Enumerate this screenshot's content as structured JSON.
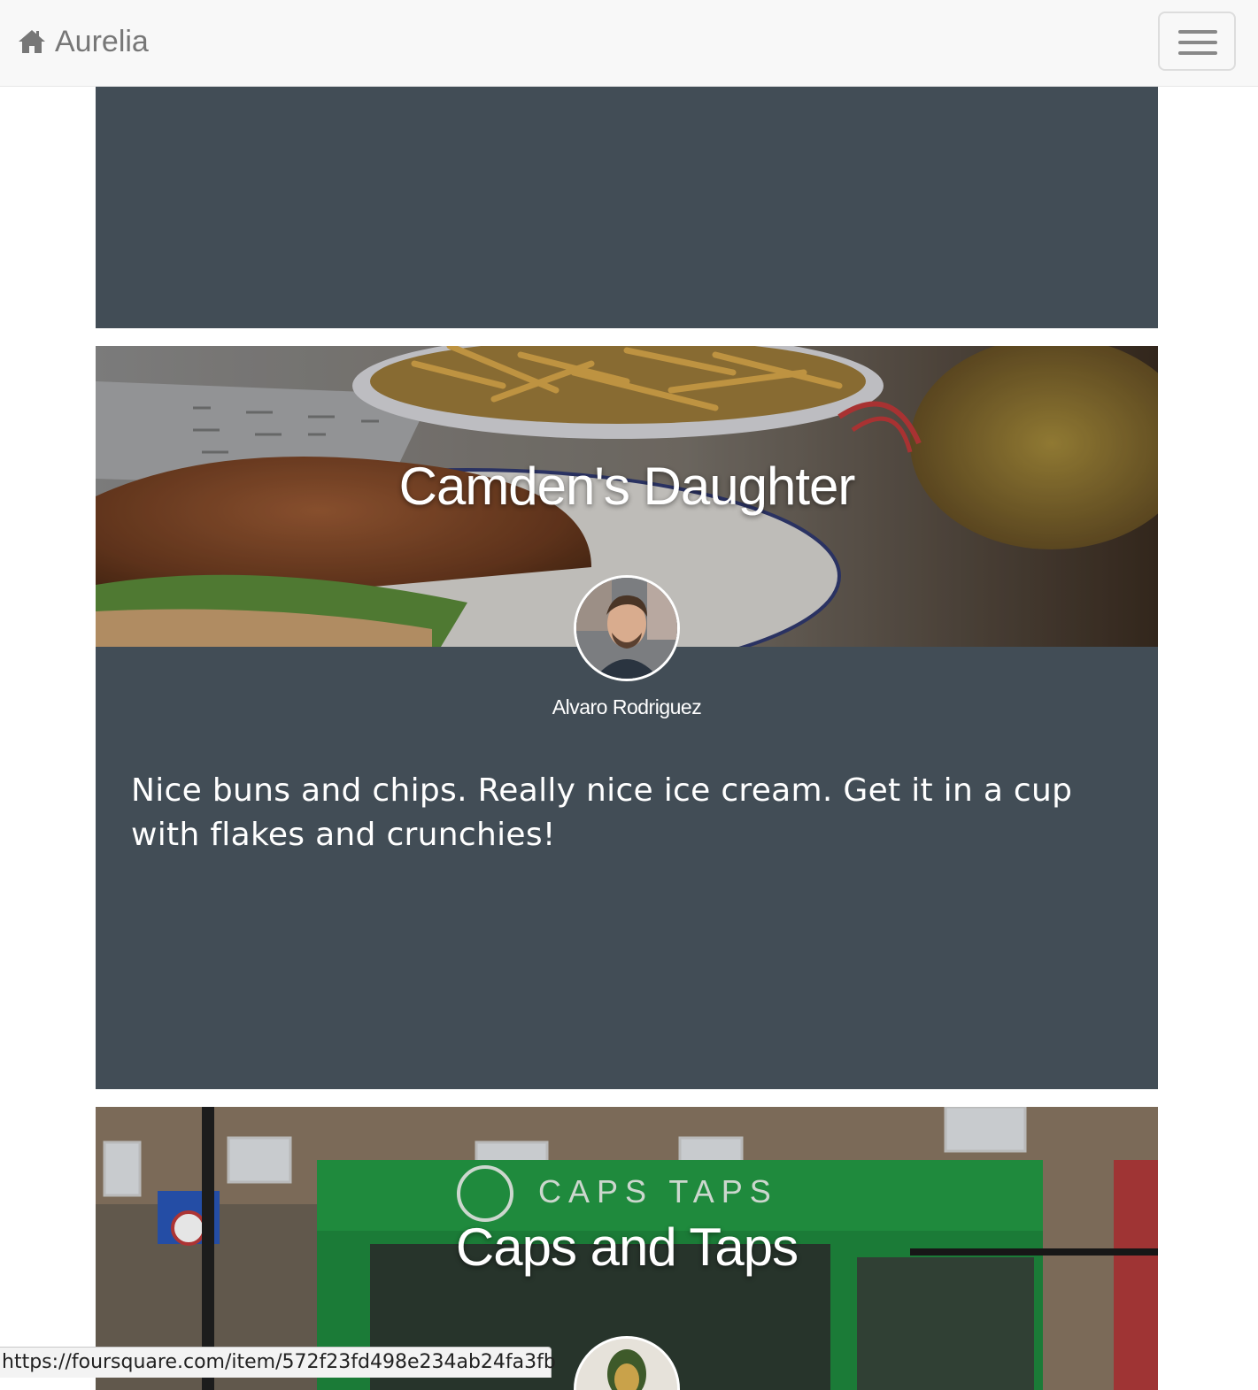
{
  "navbar": {
    "brand_label": "Aurelia",
    "brand_icon": "home-icon",
    "menu_icon": "hamburger-icon"
  },
  "venues": [
    {
      "name": "Camden's Daughter",
      "author": "Alvaro Rodriguez",
      "review": "Nice buns and chips. Really nice ice cream. Get it in a cup with flakes and crunchies!"
    },
    {
      "name": "Caps and Taps"
    }
  ],
  "statusbar": {
    "url": "https://foursquare.com/item/572f23fd498e234ab24fa3fb"
  },
  "colors": {
    "card_background": "#424d56",
    "navbar_background": "#f8f8f8",
    "brand_text": "#777777"
  }
}
